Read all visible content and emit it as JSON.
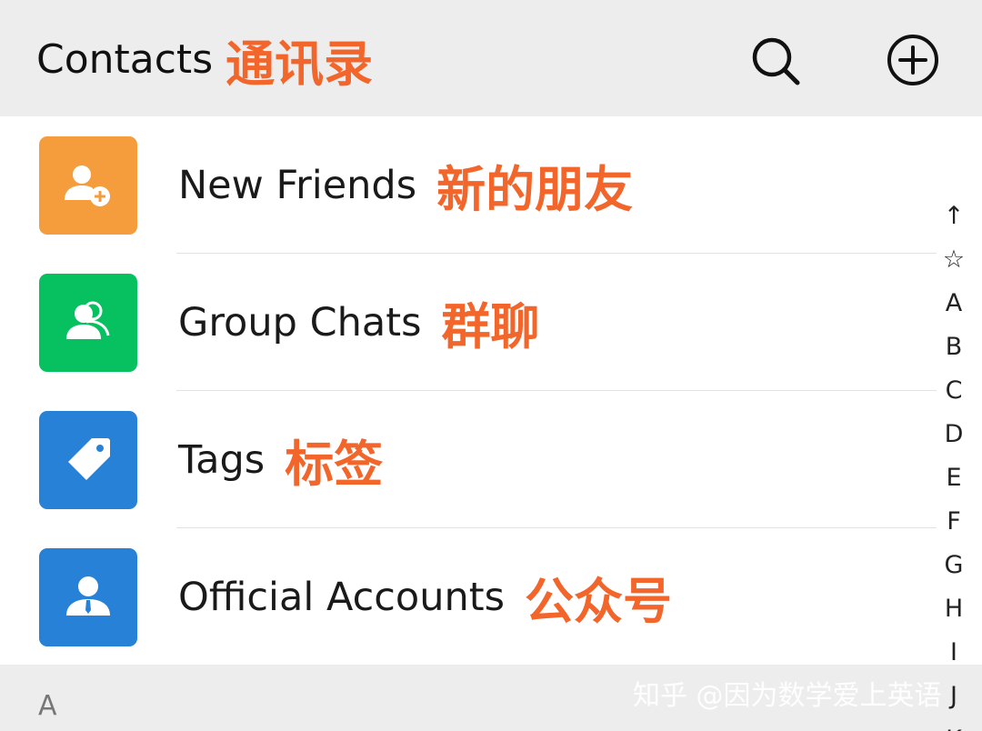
{
  "header": {
    "title_en": "Contacts",
    "title_cn": "通讯录",
    "search_icon": "search-icon",
    "add_icon": "add-circle-icon"
  },
  "menu": [
    {
      "label_en": "New Friends",
      "label_cn": "新的朋友",
      "icon": "add-friend-icon",
      "color": "#f59c3c"
    },
    {
      "label_en": "Group Chats",
      "label_cn": "群聊",
      "icon": "group-icon",
      "color": "#07c160"
    },
    {
      "label_en": "Tags",
      "label_cn": "标签",
      "icon": "tag-icon",
      "color": "#2782d7"
    },
    {
      "label_en": "Official Accounts",
      "label_cn": "公众号",
      "icon": "official-account-icon",
      "color": "#2782d7"
    }
  ],
  "section": {
    "letter": "A"
  },
  "index_bar": [
    "↑",
    "☆",
    "A",
    "B",
    "C",
    "D",
    "E",
    "F",
    "G",
    "H",
    "I",
    "J",
    "K"
  ],
  "watermark": "知乎 @因为数学爱上英语",
  "colors": {
    "annotation": "#f2652b",
    "header_bg": "#ededed"
  }
}
